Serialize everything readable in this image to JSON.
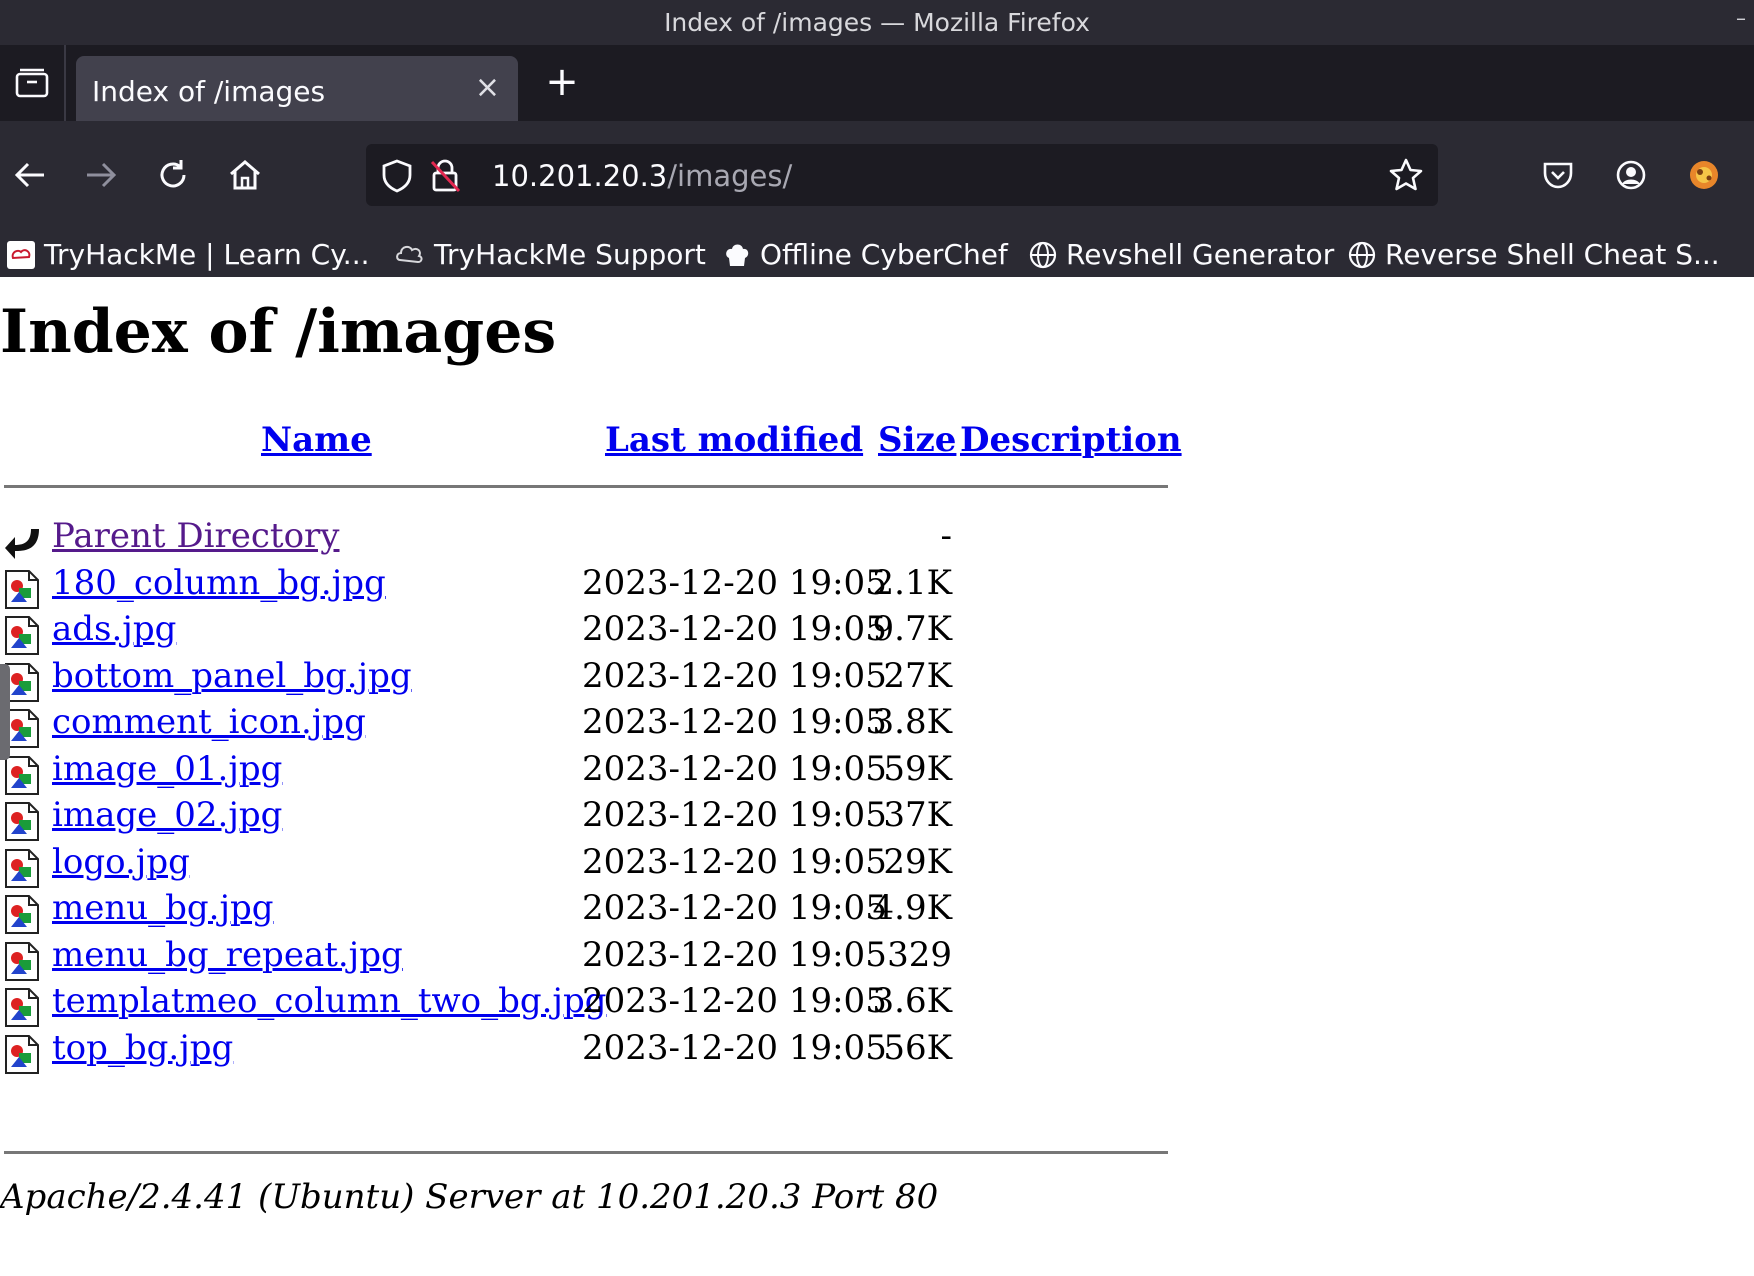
{
  "window": {
    "title": "Index of /images — Mozilla Firefox",
    "minimize": "–"
  },
  "tabs": {
    "active_label": "Index of /images",
    "close": "×",
    "new_tab": "+"
  },
  "toolbar": {
    "url_host": "10.201.20.3",
    "url_path": "/images/"
  },
  "bookmarks": [
    {
      "label": "TryHackMe | Learn Cy..."
    },
    {
      "label": "TryHackMe Support"
    },
    {
      "label": "Offline CyberChef"
    },
    {
      "label": "Revshell Generator"
    },
    {
      "label": "Reverse Shell Cheat S..."
    }
  ],
  "page": {
    "title": "Index of /images",
    "columns": {
      "name": "Name",
      "last_modified": "Last modified",
      "size": "Size",
      "description": "Description"
    },
    "parent": {
      "name": "Parent Directory",
      "size": "-"
    },
    "files": [
      {
        "name": "180_column_bg.jpg",
        "date": "2023-12-20 19:05",
        "size": "2.1K"
      },
      {
        "name": "ads.jpg",
        "date": "2023-12-20 19:05",
        "size": "9.7K"
      },
      {
        "name": "bottom_panel_bg.jpg",
        "date": "2023-12-20 19:05",
        "size": "27K"
      },
      {
        "name": "comment_icon.jpg",
        "date": "2023-12-20 19:05",
        "size": "3.8K"
      },
      {
        "name": "image_01.jpg",
        "date": "2023-12-20 19:05",
        "size": "59K"
      },
      {
        "name": "image_02.jpg",
        "date": "2023-12-20 19:05",
        "size": "37K"
      },
      {
        "name": "logo.jpg",
        "date": "2023-12-20 19:05",
        "size": "29K"
      },
      {
        "name": "menu_bg.jpg",
        "date": "2023-12-20 19:05",
        "size": "4.9K"
      },
      {
        "name": "menu_bg_repeat.jpg",
        "date": "2023-12-20 19:05",
        "size": "329"
      },
      {
        "name": "templatmeo_column_two_bg.jpg",
        "date": "2023-12-20 19:05",
        "size": "3.6K"
      },
      {
        "name": "top_bg.jpg",
        "date": "2023-12-20 19:05",
        "size": "56K"
      }
    ],
    "footer": "Apache/2.4.41 (Ubuntu) Server at 10.201.20.3 Port 80"
  },
  "colors": {
    "link": "#0000ee",
    "visited": "#551a8b",
    "chrome_dark": "#2b2a33",
    "tabstrip": "#1c1b22"
  }
}
